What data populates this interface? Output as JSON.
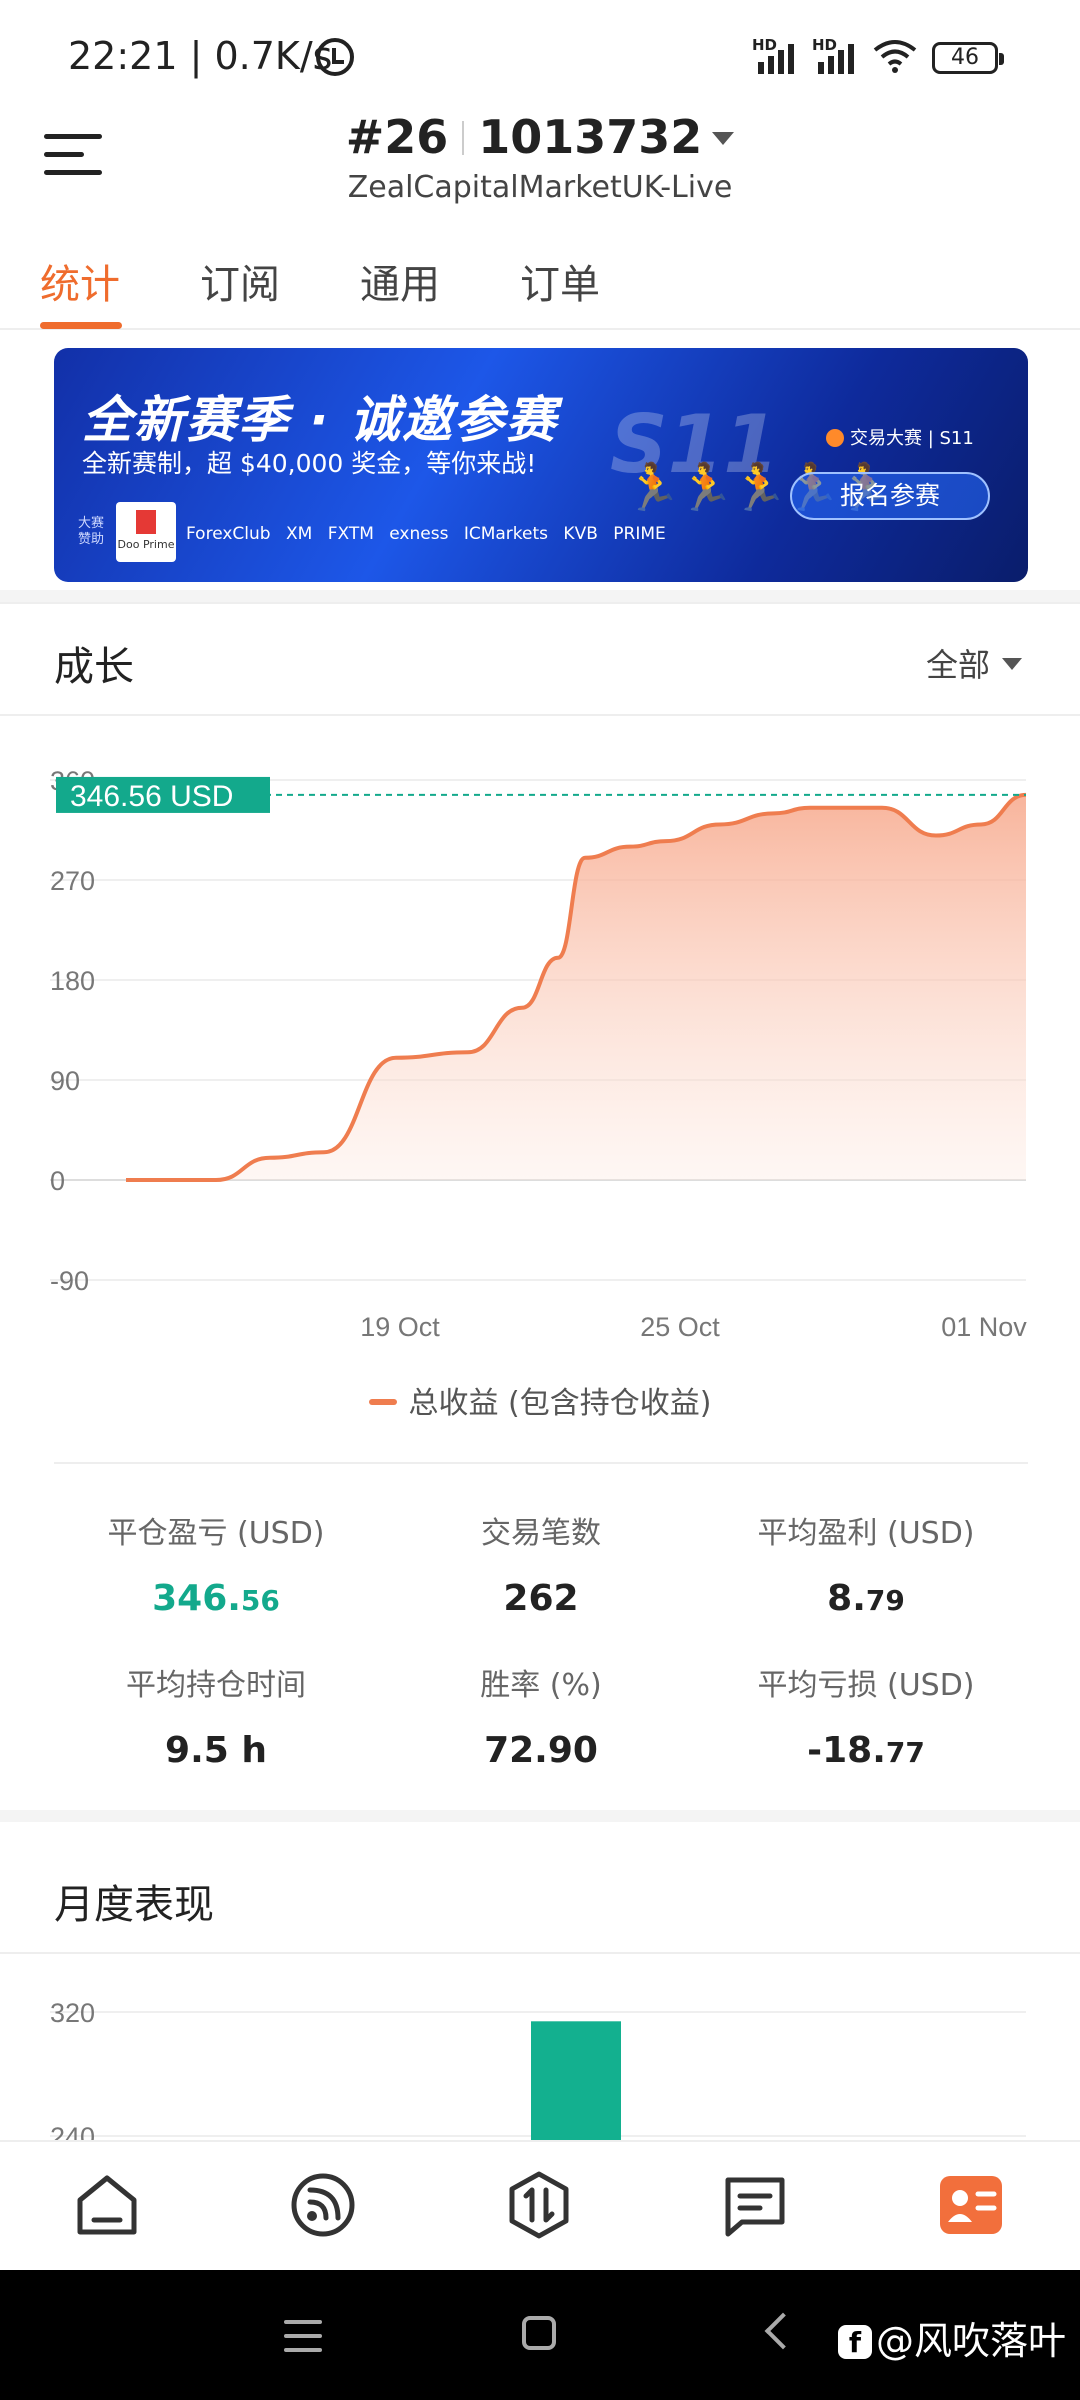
{
  "status_bar": {
    "time": "22:21",
    "net_speed": "0.7K/s",
    "battery": "46",
    "hd1": "HD",
    "hd2": "HD"
  },
  "header": {
    "account_no": "#26",
    "account_id": "1013732",
    "server": "ZealCapitalMarketUK-Live"
  },
  "tabs": [
    {
      "label": "统计",
      "active": true
    },
    {
      "label": "订阅",
      "active": false
    },
    {
      "label": "通用",
      "active": false
    },
    {
      "label": "订单",
      "active": false
    }
  ],
  "banner": {
    "headline": "全新赛季 · 诚邀参赛",
    "subtitle": "全新赛制，超 $40,000 奖金，等你来战!",
    "season": "S11",
    "brand": "交易大赛 | S11",
    "button": "报名参赛",
    "sponsor_label": "大赛赞助",
    "sponsor_main": "Doo Prime",
    "sponsors": "ForexClub XM FXTM exness ICMarkets KVB PRIME"
  },
  "growth": {
    "title": "成长",
    "range": "全部",
    "current_value_label": "346.56 USD",
    "legend": "总收益 (包含持仓收益)"
  },
  "chart_data": [
    {
      "type": "area",
      "title": "",
      "xlabel": "",
      "ylabel": "",
      "ylim": [
        -90,
        360
      ],
      "yticks": [
        "360",
        "270",
        "180",
        "90",
        "0",
        "-90"
      ],
      "xticks": [
        "19 Oct",
        "25 Oct",
        "01 Nov"
      ],
      "series": [
        {
          "name": "总收益 (包含持仓收益)",
          "color": "#ef7d4f",
          "x": [
            0,
            0.1,
            0.16,
            0.22,
            0.3,
            0.38,
            0.44,
            0.48,
            0.51,
            0.56,
            0.6,
            0.66,
            0.72,
            0.76,
            0.84,
            0.9,
            0.95,
            1.0
          ],
          "values": [
            0,
            0,
            20,
            25,
            110,
            115,
            155,
            200,
            290,
            300,
            305,
            320,
            330,
            335,
            335,
            310,
            320,
            346.56
          ]
        }
      ],
      "reference_line": 346.56,
      "grid": true
    },
    {
      "type": "bar",
      "title": "月度表现",
      "ylim": [
        240,
        320
      ],
      "yticks": [
        "320",
        "240"
      ],
      "values": [
        346.56
      ],
      "color": "#13b08f"
    }
  ],
  "stats": [
    {
      "label": "平仓盈亏 (USD)",
      "int": "346.",
      "dec": "56",
      "positive": true
    },
    {
      "label": "交易笔数",
      "int": "262",
      "dec": "",
      "positive": false
    },
    {
      "label": "平均盈利 (USD)",
      "int": "8.",
      "dec": "79",
      "positive": false
    },
    {
      "label": "平均持仓时间",
      "int": "9.5 h",
      "dec": "",
      "positive": false
    },
    {
      "label": "胜率 (%)",
      "int": "72.90",
      "dec": "",
      "positive": false
    },
    {
      "label": "平均亏损 (USD)",
      "int": "-18.",
      "dec": "77",
      "positive": false
    }
  ],
  "monthly": {
    "title": "月度表现"
  },
  "bottom_nav": [
    {
      "name": "home-icon"
    },
    {
      "name": "signal-icon"
    },
    {
      "name": "trade-icon"
    },
    {
      "name": "message-icon"
    },
    {
      "name": "profile-icon",
      "active": true
    }
  ],
  "accent_color": "#ef6c2d",
  "positive_color": "#13a98c",
  "watermark": "@风吹落叶"
}
